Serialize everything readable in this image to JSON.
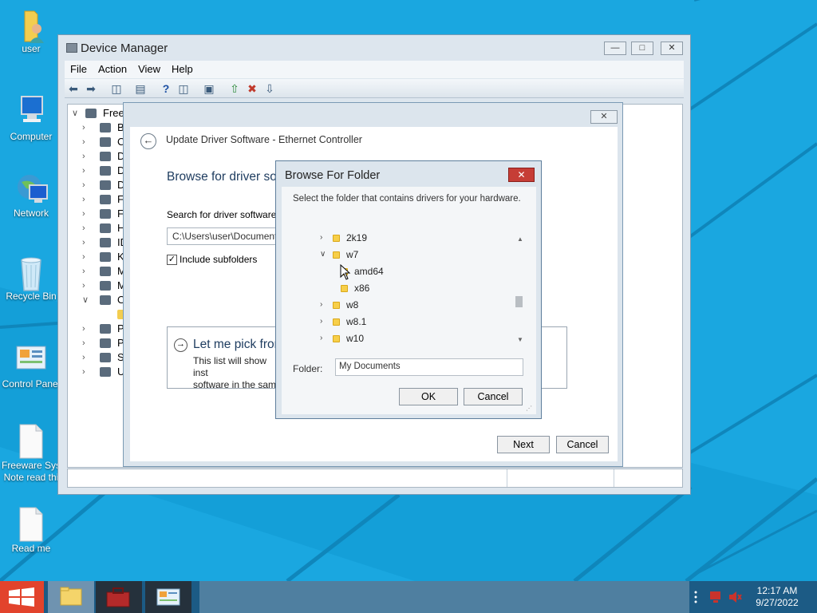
{
  "desktop": {
    "icons": [
      {
        "label": "user",
        "icon": "user-folder-icon"
      },
      {
        "label": "Computer",
        "icon": "computer-icon"
      },
      {
        "label": "Network",
        "icon": "network-icon"
      },
      {
        "label": "Recycle Bin",
        "icon": "recycle-bin-icon"
      },
      {
        "label": "Control Panel",
        "icon": "control-panel-icon"
      },
      {
        "label": "Freeware Sys Note read thi",
        "line1": "Freeware Sys",
        "line2": "Note read thi",
        "icon": "text-document-icon"
      },
      {
        "label": "Read me",
        "icon": "text-document-icon"
      }
    ]
  },
  "device_manager": {
    "title": "Device Manager",
    "menu": [
      "File",
      "Action",
      "View",
      "Help"
    ],
    "tree_root": "Freew",
    "tree_rows": [
      {
        "label": "B",
        "state": "collapsed"
      },
      {
        "label": "C",
        "state": "collapsed"
      },
      {
        "label": "D",
        "state": "collapsed"
      },
      {
        "label": "D",
        "state": "collapsed"
      },
      {
        "label": "D",
        "state": "collapsed"
      },
      {
        "label": "F",
        "state": "collapsed"
      },
      {
        "label": "F",
        "state": "collapsed"
      },
      {
        "label": "H",
        "state": "collapsed"
      },
      {
        "label": "ID",
        "state": "collapsed"
      },
      {
        "label": "K",
        "state": "collapsed"
      },
      {
        "label": "M",
        "state": "collapsed"
      },
      {
        "label": "M",
        "state": "collapsed"
      },
      {
        "label": "O",
        "state": "expanded"
      },
      {
        "label": "",
        "state": "child"
      },
      {
        "label": "P",
        "state": "collapsed"
      },
      {
        "label": "P",
        "state": "collapsed"
      },
      {
        "label": "S",
        "state": "collapsed"
      },
      {
        "label": "U",
        "state": "collapsed"
      }
    ]
  },
  "update_driver": {
    "title": "Update Driver Software - Ethernet Controller",
    "heading": "Browse for driver sof",
    "search_label": "Search for driver software in",
    "path_value": "C:\\Users\\user\\Documents",
    "include_subfolders_label": "Include subfolders",
    "include_subfolders_checked": true,
    "pick_title": "Let me pick from",
    "pick_desc_line1": "This list will show inst",
    "pick_desc_line2": "software in the same",
    "next_label": "Next",
    "cancel_label": "Cancel"
  },
  "browse_folder": {
    "title": "Browse For Folder",
    "close_symbol": "✕",
    "instruction": "Select the folder that contains drivers for your hardware.",
    "tree": [
      {
        "label": "2k19",
        "level": 0,
        "state": "collapsed"
      },
      {
        "label": "w7",
        "level": 0,
        "state": "expanded"
      },
      {
        "label": "amd64",
        "level": 1,
        "state": "none"
      },
      {
        "label": "x86",
        "level": 1,
        "state": "none"
      },
      {
        "label": "w8",
        "level": 0,
        "state": "collapsed"
      },
      {
        "label": "w8.1",
        "level": 0,
        "state": "collapsed"
      },
      {
        "label": "w10",
        "level": 0,
        "state": "collapsed"
      }
    ],
    "folder_label": "Folder:",
    "folder_value": "My Documents",
    "ok_label": "OK",
    "cancel_label": "Cancel"
  },
  "taskbar": {
    "pinned": [
      "file-explorer-icon",
      "toolbox-icon",
      "control-panel-icon"
    ],
    "clock_time": "12:17 AM",
    "clock_date": "9/27/2022"
  },
  "colors": {
    "desktop_bg": "#1aa7e0",
    "taskbar_bg": "#1c5b85",
    "close_red": "#c63d36",
    "heading_blue": "#1f3d60"
  }
}
